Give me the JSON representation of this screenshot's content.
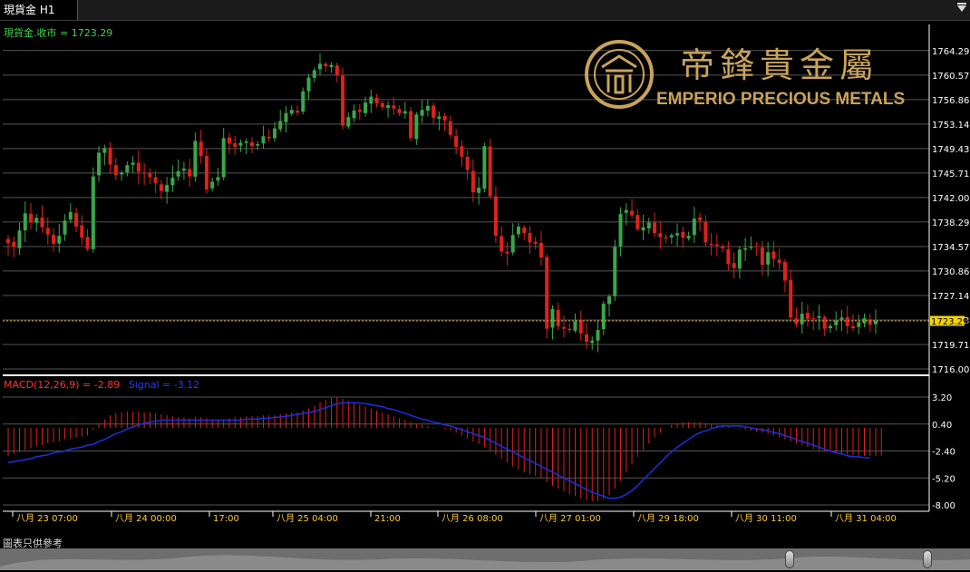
{
  "tab": {
    "label": "現貨金 H1"
  },
  "header": {
    "price_label": "現貨金.收市 = 1723.29"
  },
  "brand": {
    "chinese": "帝鋒貴金屬",
    "english": "EMPERIO PRECIOUS METALS",
    "gold": "#c9a35a"
  },
  "current_price": "1723.29",
  "macd": {
    "label": "MACD(12,26,9) = -2.89",
    "signal_label": "Signal = -3.12"
  },
  "footer": {
    "disclaimer": "圖表只供參考"
  },
  "colors": {
    "up": "#3aa64a",
    "down": "#e0201a",
    "axis": "#ffffff",
    "time": "#ffcc33",
    "grid": "#555555",
    "signal": "#1e2ee0",
    "priceline": "#d9a020"
  },
  "chart_data": [
    {
      "type": "candlestick",
      "title": "現貨金 H1",
      "ylim": [
        1716.0,
        1765.5
      ],
      "y_ticks": [
        "1764.29",
        "1760.57",
        "1756.86",
        "1753.14",
        "1749.43",
        "1745.71",
        "1742.00",
        "1738.29",
        "1734.57",
        "1730.86",
        "1727.14",
        "1723.43",
        "1719.71",
        "1716.00"
      ],
      "x_ticks": [
        "八月 23 07:00",
        "八月 24 00:00",
        "17:00",
        "八月 25 04:00",
        "21:00",
        "八月 26 08:00",
        "八月 27 01:00",
        "八月 29 18:00",
        "八月 30 11:00",
        "八月 31 04:00"
      ],
      "last_close": 1723.29,
      "closes": [
        1735.1,
        1734.5,
        1737.0,
        1739.6,
        1738.2,
        1738.9,
        1737.5,
        1736.4,
        1735.0,
        1736.2,
        1738.5,
        1739.8,
        1737.6,
        1735.9,
        1734.2,
        1745.2,
        1748.8,
        1749.5,
        1747.0,
        1745.4,
        1745.8,
        1746.9,
        1747.3,
        1745.9,
        1745.7,
        1745.1,
        1744.2,
        1743.0,
        1743.9,
        1745.0,
        1746.0,
        1746.4,
        1745.2,
        1750.6,
        1748.3,
        1743.2,
        1744.4,
        1745.1,
        1751.0,
        1750.2,
        1749.7,
        1750.3,
        1750.5,
        1749.8,
        1750.1,
        1751.3,
        1751.0,
        1752.5,
        1753.6,
        1754.8,
        1755.3,
        1754.9,
        1758.1,
        1760.2,
        1761.3,
        1762.3,
        1761.9,
        1762.1,
        1760.6,
        1752.9,
        1754.2,
        1755.2,
        1755.0,
        1756.4,
        1757.3,
        1756.3,
        1755.7,
        1756.0,
        1755.5,
        1754.8,
        1755.1,
        1751.0,
        1754.6,
        1755.3,
        1755.9,
        1754.1,
        1754.3,
        1753.7,
        1751.5,
        1749.7,
        1748.2,
        1746.2,
        1742.8,
        1743.5,
        1749.8,
        1742.2,
        1736.2,
        1733.8,
        1733.5,
        1736.3,
        1737.6,
        1736.6,
        1735.2,
        1735.0,
        1732.9,
        1722.1,
        1725.1,
        1722.5,
        1722.1,
        1721.9,
        1723.2,
        1721.4,
        1720.1,
        1720.3,
        1721.9,
        1725.9,
        1727.0,
        1734.5,
        1739.5,
        1740.1,
        1739.3,
        1737.2,
        1737.5,
        1738.2,
        1736.6,
        1736.0,
        1735.8,
        1736.3,
        1736.6,
        1735.9,
        1736.2,
        1738.8,
        1738.5,
        1735.2,
        1734.8,
        1734.7,
        1734.3,
        1731.9,
        1731.3,
        1734.1,
        1734.3,
        1734.5,
        1734.6,
        1731.8,
        1733.7,
        1732.7,
        1732.1,
        1729.4,
        1723.8,
        1722.8,
        1724.4,
        1723.6,
        1723.6,
        1724.0,
        1722.1,
        1722.5,
        1723.3,
        1723.8,
        1722.5,
        1722.2,
        1723.1,
        1723.7,
        1722.7,
        1723.29
      ]
    },
    {
      "type": "bar+line",
      "title": "MACD(12,26,9)",
      "ylim": [
        -8.0,
        3.2
      ],
      "y_ticks": [
        "3.20",
        "0.40",
        "-2.40",
        "-5.20",
        "-8.00"
      ],
      "macd_last": -2.89,
      "signal_last": -3.12,
      "macd": [
        -2.9,
        -2.7,
        -2.5,
        -2.3,
        -2.1,
        -1.9,
        -1.8,
        -1.6,
        -1.5,
        -1.4,
        -1.2,
        -1.1,
        -1.0,
        -0.9,
        -0.8,
        -0.2,
        0.5,
        0.9,
        1.3,
        1.5,
        1.6,
        1.7,
        1.7,
        1.7,
        1.6,
        1.6,
        1.5,
        1.4,
        1.3,
        1.2,
        1.1,
        1.1,
        1.0,
        1.1,
        1.1,
        1.0,
        0.9,
        0.8,
        0.9,
        1.0,
        1.1,
        1.1,
        1.2,
        1.2,
        1.2,
        1.3,
        1.3,
        1.3,
        1.4,
        1.5,
        1.6,
        1.6,
        1.8,
        2.0,
        2.3,
        2.7,
        2.9,
        3.1,
        3.2,
        3.0,
        2.8,
        2.6,
        2.4,
        2.2,
        2.0,
        1.8,
        1.6,
        1.4,
        1.2,
        1.0,
        0.8,
        0.6,
        0.4,
        0.3,
        0.2,
        0.1,
        0.0,
        -0.1,
        -0.3,
        -0.5,
        -0.8,
        -1.1,
        -1.4,
        -1.7,
        -2.0,
        -2.4,
        -2.8,
        -3.2,
        -3.6,
        -4.0,
        -4.3,
        -4.6,
        -4.8,
        -5.0,
        -5.2,
        -5.6,
        -6.0,
        -6.3,
        -6.6,
        -6.9,
        -7.1,
        -7.3,
        -7.5,
        -7.6,
        -7.6,
        -7.4,
        -7.0,
        -6.3,
        -5.5,
        -4.6,
        -3.8,
        -3.0,
        -2.3,
        -1.6,
        -1.0,
        -0.5,
        0.0,
        0.3,
        0.5,
        0.6,
        0.6,
        0.6,
        0.6,
        0.5,
        0.4,
        0.3,
        0.2,
        0.1,
        0.0,
        -0.1,
        -0.2,
        -0.3,
        -0.4,
        -0.5,
        -0.6,
        -0.8,
        -1.0,
        -1.2,
        -1.4,
        -1.6,
        -1.8,
        -2.0,
        -2.2,
        -2.3,
        -2.4,
        -2.5,
        -2.6,
        -2.7,
        -2.8,
        -2.8,
        -2.9,
        -2.9,
        -2.9,
        -2.9,
        -2.89
      ],
      "signal": [
        -3.6,
        -3.5,
        -3.4,
        -3.3,
        -3.2,
        -3.0,
        -2.9,
        -2.8,
        -2.6,
        -2.5,
        -2.4,
        -2.2,
        -2.1,
        -2.0,
        -1.8,
        -1.7,
        -1.4,
        -1.2,
        -0.9,
        -0.6,
        -0.4,
        -0.1,
        0.1,
        0.3,
        0.5,
        0.6,
        0.7,
        0.8,
        0.8,
        0.8,
        0.8,
        0.8,
        0.8,
        0.8,
        0.8,
        0.8,
        0.8,
        0.8,
        0.8,
        0.8,
        0.8,
        0.8,
        0.9,
        0.9,
        0.9,
        1.0,
        1.0,
        1.1,
        1.1,
        1.2,
        1.3,
        1.4,
        1.5,
        1.6,
        1.7,
        1.9,
        2.1,
        2.3,
        2.5,
        2.6,
        2.6,
        2.6,
        2.6,
        2.5,
        2.4,
        2.3,
        2.2,
        2.0,
        1.9,
        1.7,
        1.5,
        1.3,
        1.1,
        0.9,
        0.8,
        0.6,
        0.5,
        0.3,
        0.2,
        0.0,
        -0.2,
        -0.4,
        -0.6,
        -0.8,
        -1.0,
        -1.3,
        -1.6,
        -1.9,
        -2.2,
        -2.5,
        -2.8,
        -3.1,
        -3.4,
        -3.7,
        -4.0,
        -4.3,
        -4.6,
        -4.9,
        -5.2,
        -5.5,
        -5.8,
        -6.1,
        -6.4,
        -6.7,
        -6.9,
        -7.1,
        -7.3,
        -7.3,
        -7.2,
        -6.9,
        -6.5,
        -6.0,
        -5.4,
        -4.8,
        -4.2,
        -3.6,
        -3.0,
        -2.5,
        -2.0,
        -1.6,
        -1.2,
        -0.8,
        -0.5,
        -0.3,
        -0.1,
        0.1,
        0.2,
        0.2,
        0.2,
        0.2,
        0.1,
        0.0,
        -0.1,
        -0.2,
        -0.3,
        -0.5,
        -0.6,
        -0.8,
        -1.0,
        -1.2,
        -1.4,
        -1.6,
        -1.8,
        -2.0,
        -2.2,
        -2.4,
        -2.6,
        -2.7,
        -2.9,
        -3.0,
        -3.0,
        -3.1,
        -3.12
      ]
    }
  ]
}
